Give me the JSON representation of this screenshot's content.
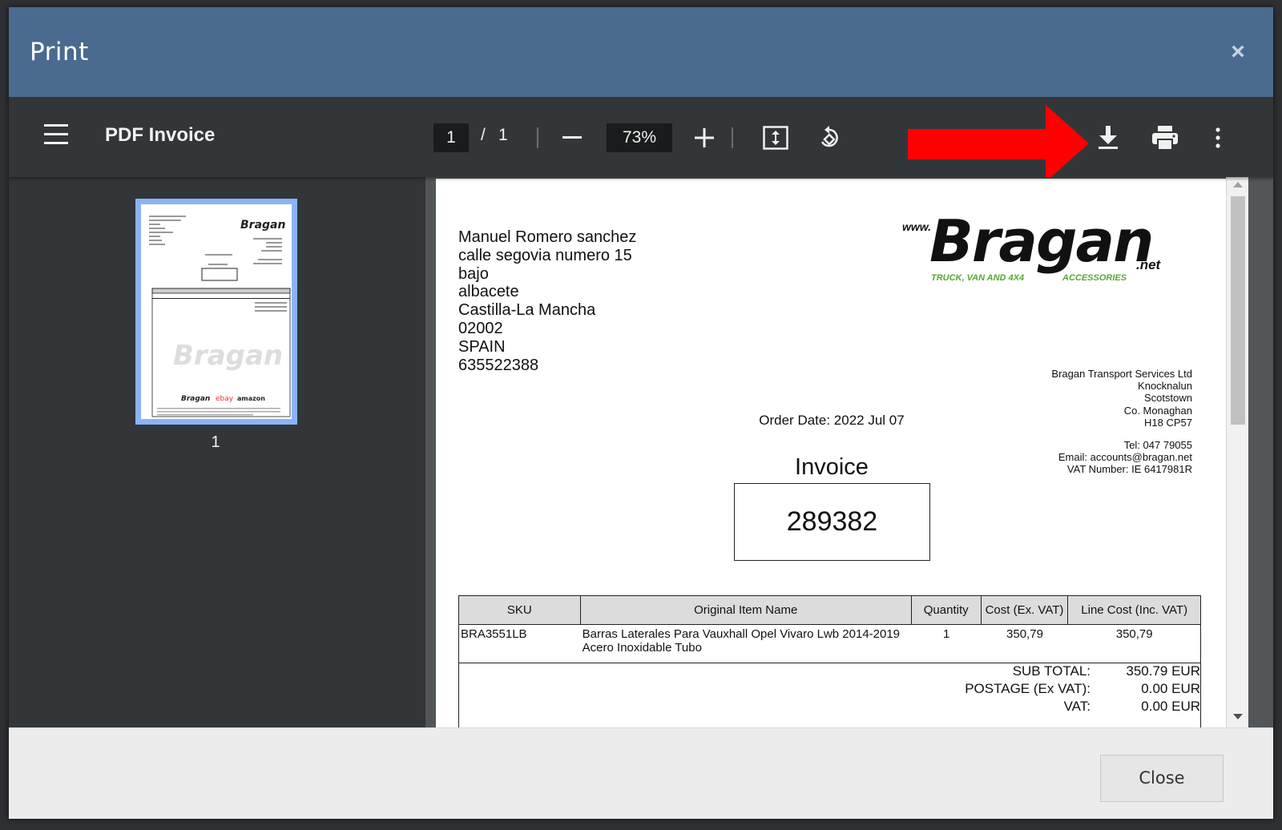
{
  "dialog": {
    "title": "Print",
    "close_button": "Close"
  },
  "viewer": {
    "document_title": "PDF Invoice",
    "current_page": "1",
    "page_separator": "/",
    "total_pages": "1",
    "zoom": "73%",
    "thumbnail_label": "1"
  },
  "invoice": {
    "customer": [
      "Manuel Romero sanchez",
      "calle segovia numero 15",
      "bajo",
      "albacete",
      "Castilla-La Mancha",
      "02002",
      "SPAIN",
      "635522388"
    ],
    "logo": {
      "www": "www.",
      "name": "Bragan",
      "suffix": ".net",
      "tagline_left": "TRUCK, VAN AND 4X4",
      "tagline_right": "ACCESSORIES"
    },
    "company": [
      "Bragan Transport Services Ltd",
      "Knocknalun",
      "Scotstown",
      "Co. Monaghan",
      "H18 CP57"
    ],
    "contact": [
      "Tel:  047 79055",
      "Email: accounts@bragan.net",
      "VAT Number: IE 6417981R"
    ],
    "order_date": "Order Date: 2022 Jul 07",
    "label": "Invoice",
    "number": "289382",
    "columns": [
      "SKU",
      "Original Item Name",
      "Quantity",
      "Cost (Ex. VAT)",
      "Line Cost (Inc. VAT)"
    ],
    "items": [
      {
        "sku": "BRA3551LB",
        "name": "Barras Laterales Para Vauxhall Opel Vivaro Lwb 2014-2019 Acero Inoxidable Tubo",
        "qty": "1",
        "cost": "350,79",
        "line": "350,79"
      }
    ],
    "totals": [
      {
        "label": "SUB TOTAL:",
        "value": "350.79 EUR"
      },
      {
        "label": "POSTAGE (Ex VAT):",
        "value": "0.00 EUR"
      },
      {
        "label": "VAT:",
        "value": "0.00 EUR"
      }
    ]
  },
  "colors": {
    "header": "#4a6a90",
    "toolbar": "#323639",
    "annotation_arrow": "#ff0000",
    "logo_green": "#5aa832"
  }
}
